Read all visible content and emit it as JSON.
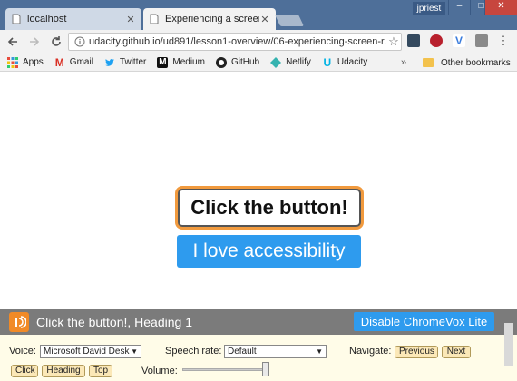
{
  "browser": {
    "tabs": [
      {
        "label": "localhost",
        "active": false
      },
      {
        "label": "Experiencing a screen rea",
        "active": true
      }
    ],
    "user": "jpriest",
    "window_controls": {
      "minimize": "–",
      "maximize": "□",
      "close": "✕"
    },
    "address": {
      "url": "udacity.github.io/ud891/lesson1-overview/06-experiencing-screen-r..."
    },
    "bookmarks": [
      {
        "label": "Apps",
        "icon": "apps-icon"
      },
      {
        "label": "Gmail",
        "icon": "gmail-icon"
      },
      {
        "label": "Twitter",
        "icon": "twitter-icon"
      },
      {
        "label": "Medium",
        "icon": "medium-icon"
      },
      {
        "label": "GitHub",
        "icon": "github-icon"
      },
      {
        "label": "Netlify",
        "icon": "netlify-icon"
      },
      {
        "label": "Udacity",
        "icon": "udacity-icon"
      }
    ],
    "bookmarks_more": "»",
    "other_bookmarks": "Other bookmarks"
  },
  "page": {
    "click_button_label": "Click the button!",
    "accessibility_button_label": "I love accessibility"
  },
  "chromevox": {
    "status": "Click the button!, Heading 1",
    "disable_label": "Disable ChromeVox Lite",
    "voice_label": "Voice:",
    "voice_value": "Microsoft David Desk",
    "speech_rate_label": "Speech rate:",
    "speech_rate_value": "Default",
    "navigate_label": "Navigate:",
    "previous_label": "Previous",
    "next_label": "Next",
    "click_label": "Click",
    "heading_label": "Heading",
    "top_label": "Top",
    "volume_label": "Volume:",
    "volume_level": 1.0
  },
  "colors": {
    "titlebar": "#4e6f99",
    "primary_button": "#2e9bee",
    "focus_ring": "#f19a3e",
    "chromevox_header": "#7b7b7b",
    "chromevox_body": "#fffce8"
  }
}
